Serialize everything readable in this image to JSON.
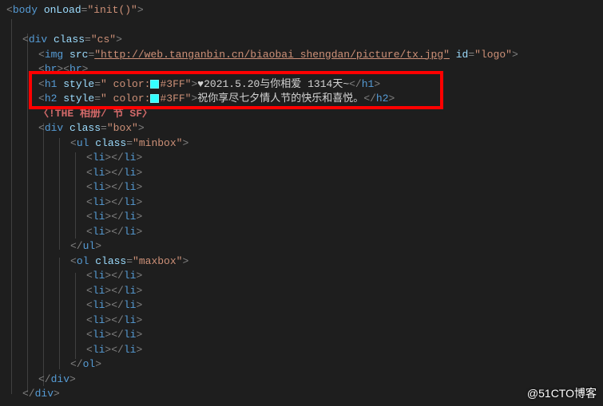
{
  "lines": {
    "l0_open": "<",
    "l0_tag": "body",
    "l0_attr1": " onLoad",
    "l0_eq": "=",
    "l0_val1": "\"init()\"",
    "l0_close": ">",
    "l1_open": "<",
    "l1_tag": "div",
    "l1_attr1": " class",
    "l1_val1": "\"cs\"",
    "l1_close": ">",
    "l2_open": "<",
    "l2_tag": "img",
    "l2_attr1": " src",
    "l2_val1": "\"http://web.tanganbin.cn/biaobai_shengdan/picture/tx.jpg\"",
    "l2_attr2": " id",
    "l2_val2": "\"logo\"",
    "l2_close": ">",
    "l3_text": "<br><br>",
    "l4_open": "<",
    "l4_tag": "h1",
    "l4_attr1": " style",
    "l4_val1a": "\" color:",
    "l4_val1b": "#3FF\"",
    "l4_close": ">",
    "l4_content": "♥2021.5.20与你相爱 1314天~",
    "l4_endopen": "</",
    "l4_endtag": "h1",
    "l4_endclose": ">",
    "l5_open": "<",
    "l5_tag": "h2",
    "l5_attr1": " style",
    "l5_val1a": "\" color:",
    "l5_val1b": "#3FF\"",
    "l5_close": ">",
    "l5_content": "祝你享尽七夕情人节的快乐和喜悦。",
    "l5_endopen": "</",
    "l5_endtag": "h2",
    "l5_endclose": ">",
    "l6_text": "〈!THE 相册/ 节 SF〉",
    "l7_open": "<",
    "l7_tag": "div",
    "l7_attr1": " class",
    "l7_val1": "\"box\"",
    "l7_close": ">",
    "l8_open": "<",
    "l8_tag": "ul",
    "l8_attr1": " class",
    "l8_val1": "\"minbox\"",
    "l8_close": ">",
    "li_open": "<",
    "li_tag": "li",
    "li_close": ">",
    "li_endopen": "</",
    "li_endclose": ">",
    "ul_end": "ul",
    "l16_open": "<",
    "l16_tag": "ol",
    "l16_attr1": " class",
    "l16_val1": "\"maxbox\"",
    "l16_close": ">",
    "ol_end": "ol",
    "div_end": "div",
    "swatch_color": "#33ffff"
  },
  "watermark": "@51CTO博客"
}
